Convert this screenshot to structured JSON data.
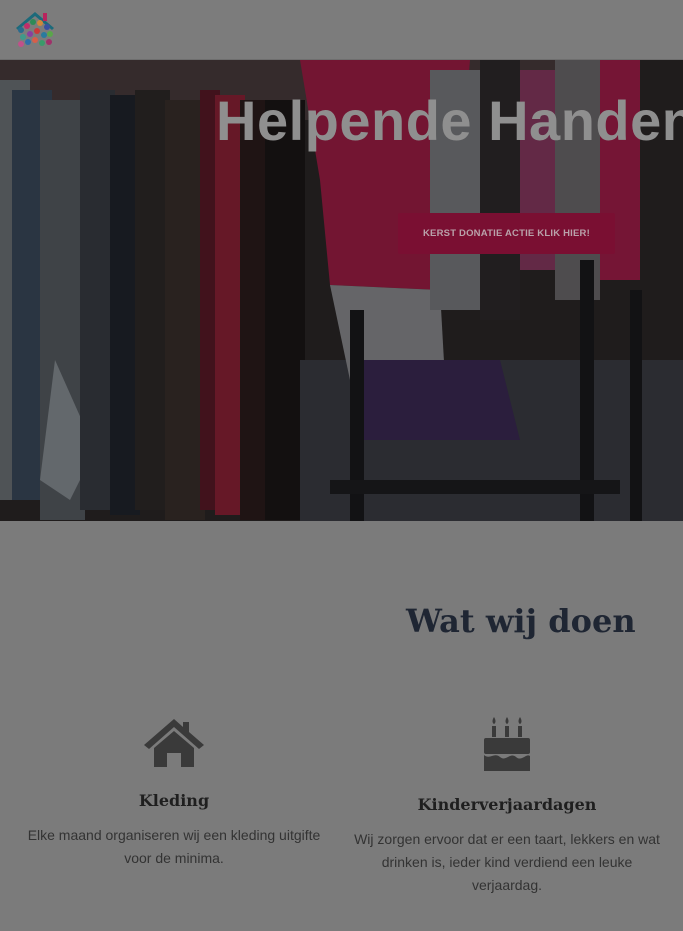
{
  "header": {
    "logo_icon": "helpende-handen-logo"
  },
  "hero": {
    "title": "Helpende Handen",
    "cta_label": "KERST DONATIE ACTIE KLIK HIER!",
    "cta_color": "#7a0f32"
  },
  "section": {
    "title": "Wat wij doen"
  },
  "features": [
    {
      "icon": "house-icon",
      "title": "Kleding",
      "text": "Elke maand organiseren wij een kleding uitgifte voor de minima."
    },
    {
      "icon": "birthday-cake-icon",
      "title": "Kinderverjaardagen",
      "text": "Wij zorgen ervoor dat er een taart, lekkers en wat drinken is, ieder kind verdiend een leuke verjaardag."
    }
  ]
}
